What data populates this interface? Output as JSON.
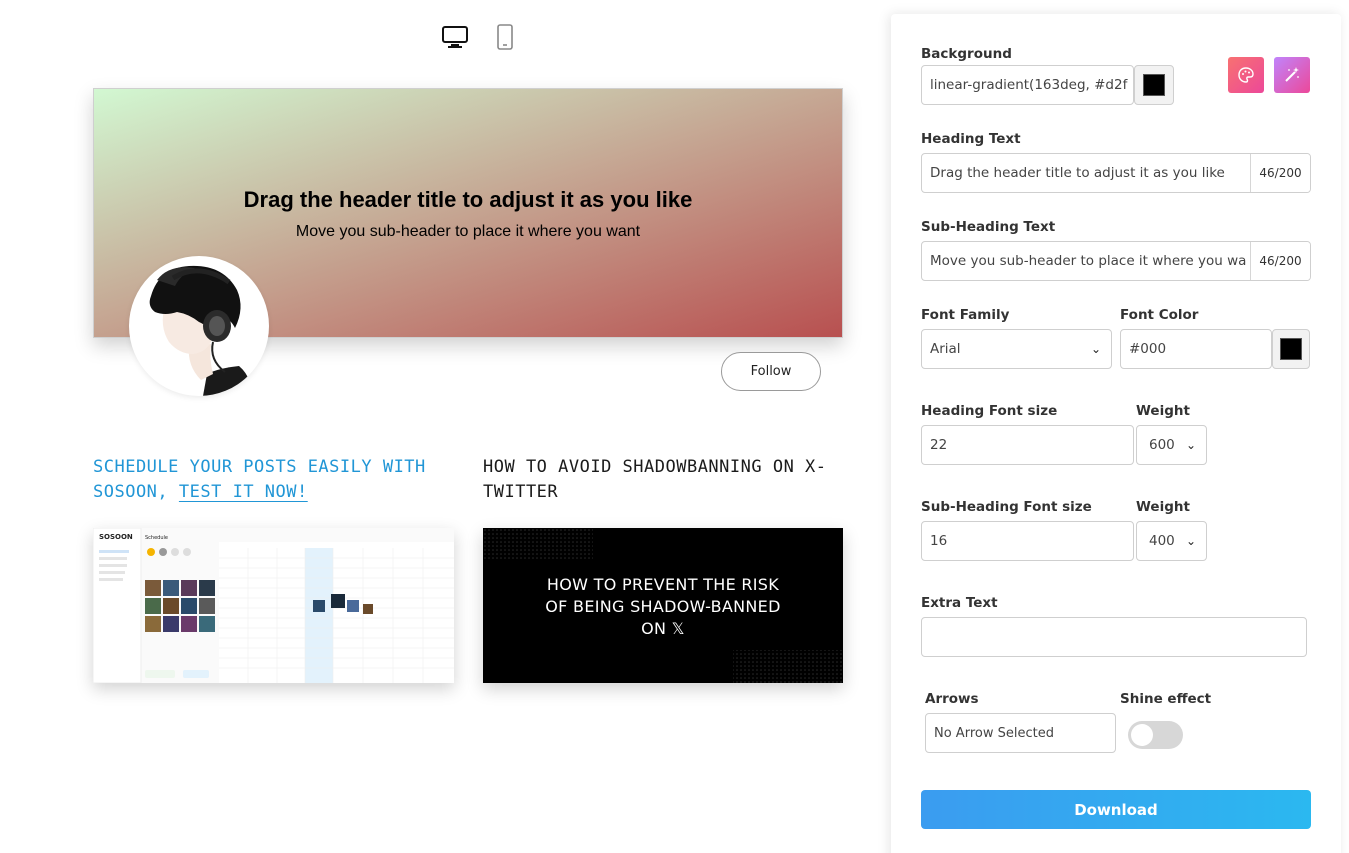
{
  "toolbar": {
    "desktop_icon": "monitor-icon",
    "mobile_icon": "smartphone-icon"
  },
  "banner": {
    "background": "linear-gradient(163deg, #d2f8d2 0%, #b85050 100%)",
    "heading": "Drag the header title to adjust it as you like",
    "subheading": "Move you sub-header to place it where you want",
    "follow_label": "Follow"
  },
  "articles": [
    {
      "title_part1": "Schedule your posts easily with SOSOON,",
      "title_cta": "test it now!",
      "image_alt": "sosoon-scheduler-screenshot",
      "accent": "#2196d6"
    },
    {
      "title": "How to avoid shadowbanning on X-Twitter",
      "image_line1": "HOW TO PREVENT THE RISK",
      "image_line2": "OF BEING SHADOW-BANNED",
      "image_line3": "ON 𝕏"
    }
  ],
  "panel": {
    "background_label": "Background",
    "background_value": "linear-gradient(163deg, #d2f",
    "background_swatch": "#000000",
    "heading_label": "Heading Text",
    "heading_value": "Drag the header title to adjust it as you like",
    "heading_counter": "46/200",
    "subheading_label": "Sub-Heading Text",
    "subheading_value": "Move you sub-header to place it where you wa",
    "subheading_counter": "46/200",
    "font_family_label": "Font Family",
    "font_family_value": "Arial",
    "font_color_label": "Font Color",
    "font_color_value": "#000",
    "font_color_swatch": "#000000",
    "heading_size_label": "Heading Font size",
    "heading_size_value": "22",
    "heading_weight_label": "Weight",
    "heading_weight_value": "600",
    "sub_size_label": "Sub-Heading Font size",
    "sub_size_value": "16",
    "sub_weight_label": "Weight",
    "sub_weight_value": "400",
    "extra_text_label": "Extra Text",
    "extra_text_value": "",
    "arrows_label": "Arrows",
    "arrows_value": "No Arrow Selected",
    "shine_label": "Shine effect",
    "shine_enabled": false,
    "download_label": "Download"
  },
  "colors": {
    "accent_blue": "#2196d6",
    "download_gradient_start": "#3b9cf0",
    "download_gradient_end": "#2bb8f0"
  }
}
